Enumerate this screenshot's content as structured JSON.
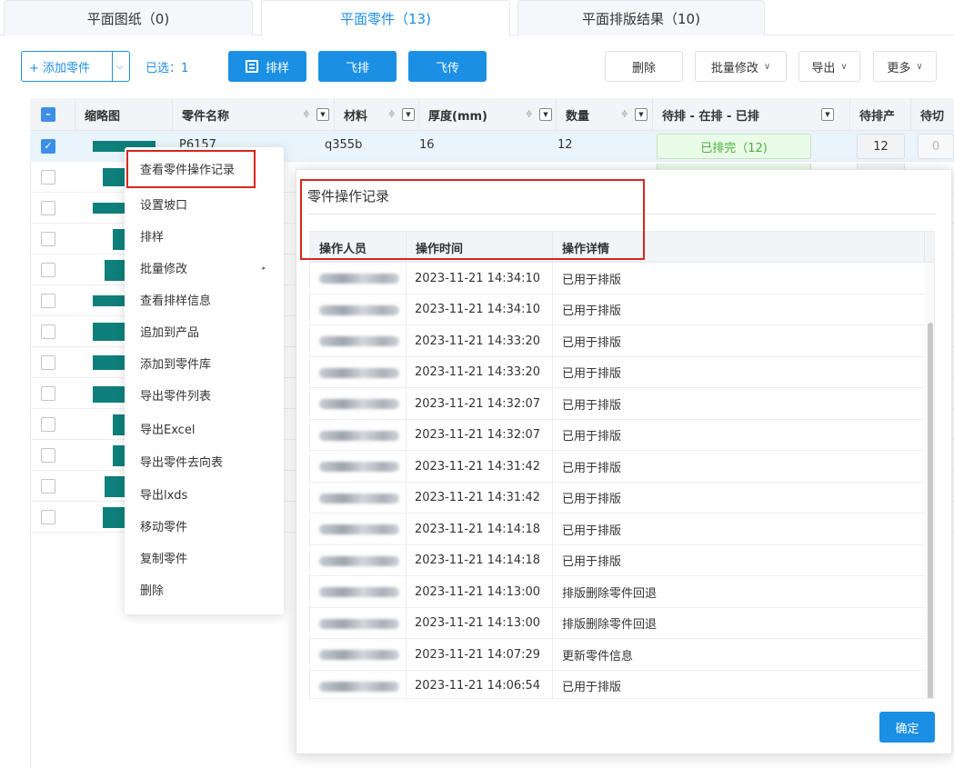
{
  "tabs": [
    {
      "label": "平面图纸（0)"
    },
    {
      "label": "平面零件（13)"
    },
    {
      "label": "平面排版结果（10)"
    }
  ],
  "toolbar": {
    "add_part": "+ 添加零件",
    "selected": "已选：1",
    "nest": "排样",
    "fly_nest": "飞排",
    "fly_transfer": "飞传",
    "delete": "删除",
    "batch_edit": "批量修改",
    "export": "导出",
    "more": "更多"
  },
  "table": {
    "headers": {
      "thumb": "缩略图",
      "name": "零件名称",
      "material": "材料",
      "thickness": "厚度(mm)",
      "quantity": "数量",
      "status": "待排 - 在排 - 已排",
      "pending_prod": "待排产",
      "pending_cut": "待切"
    },
    "first_row": {
      "name": "P6157",
      "material": "q355b",
      "thickness": "16",
      "quantity": "12",
      "status": "已排完（12)",
      "pending_prod": "12",
      "pending_cut": "0"
    }
  },
  "context_menu": {
    "items": [
      "查看零件操作记录",
      "设置坡口",
      "排样",
      "批量修改",
      "查看排样信息",
      "追加到产品",
      "添加到零件库",
      "导出零件列表",
      "导出Excel",
      "导出零件去向表",
      "导出lxds",
      "移动零件",
      "复制零件",
      "删除"
    ]
  },
  "dialog": {
    "title": "零件操作记录",
    "headers": {
      "operator": "操作人员",
      "time": "操作时间",
      "detail": "操作详情"
    },
    "rows": [
      {
        "time": "2023-11-21 14:34:10",
        "detail": "已用于排版"
      },
      {
        "time": "2023-11-21 14:34:10",
        "detail": "已用于排版"
      },
      {
        "time": "2023-11-21 14:33:20",
        "detail": "已用于排版"
      },
      {
        "time": "2023-11-21 14:33:20",
        "detail": "已用于排版"
      },
      {
        "time": "2023-11-21 14:32:07",
        "detail": "已用于排版"
      },
      {
        "time": "2023-11-21 14:32:07",
        "detail": "已用于排版"
      },
      {
        "time": "2023-11-21 14:31:42",
        "detail": "已用于排版"
      },
      {
        "time": "2023-11-21 14:31:42",
        "detail": "已用于排版"
      },
      {
        "time": "2023-11-21 14:14:18",
        "detail": "已用于排版"
      },
      {
        "time": "2023-11-21 14:14:18",
        "detail": "已用于排版"
      },
      {
        "time": "2023-11-21 14:13:00",
        "detail": "排版删除零件回退"
      },
      {
        "time": "2023-11-21 14:13:00",
        "detail": "排版删除零件回退"
      },
      {
        "time": "2023-11-21 14:07:29",
        "detail": "更新零件信息"
      },
      {
        "time": "2023-11-21 14:06:54",
        "detail": "已用于排版"
      }
    ],
    "ok": "确定"
  }
}
